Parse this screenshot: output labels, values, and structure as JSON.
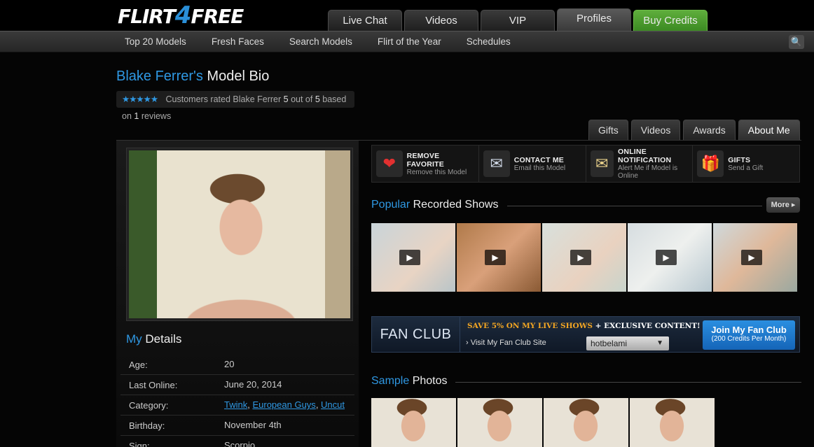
{
  "header": {
    "logo_main": "FLIRT",
    "logo_four": "4",
    "logo_end": "FREE",
    "tabs": [
      {
        "label": "Live Chat"
      },
      {
        "label": "Videos"
      },
      {
        "label": "VIP"
      },
      {
        "label": "Profiles"
      },
      {
        "label": "Buy Credits"
      }
    ]
  },
  "subnav": {
    "items": [
      "Top 20 Models",
      "Fresh Faces",
      "Search Models",
      "Flirt of the Year",
      "Schedules"
    ],
    "search_icon": "🔍"
  },
  "profile": {
    "name_possessive": "Blake Ferrer's",
    "title_suffix": "Model Bio",
    "stars": "★★★★★",
    "rating_prefix": "Customers rated Blake Ferrer",
    "rating_value": "5",
    "rating_mid": "out of",
    "rating_max": "5",
    "rating_based": "based on",
    "review_count": "1",
    "rating_suffix": "reviews",
    "rating_fraction": 1.0
  },
  "profile_tabs": [
    "Gifts",
    "Videos",
    "Awards",
    "About Me"
  ],
  "actions": [
    {
      "icon": "heart-icon",
      "glyph": "❤",
      "title": "REMOVE FAVORITE",
      "sub": "Remove this Model"
    },
    {
      "icon": "envelope-icon",
      "glyph": "✉",
      "title": "CONTACT ME",
      "sub": "Email this Model"
    },
    {
      "icon": "notification-icon",
      "glyph": "✉",
      "title": "ONLINE NOTIFICATION",
      "sub": "Alert Me if Model is Online"
    },
    {
      "icon": "gift-icon",
      "glyph": "🎁",
      "title": "GIFTS",
      "sub": "Send a Gift"
    }
  ],
  "recorded": {
    "title_hl": "Popular",
    "title": "Recorded Shows",
    "more": "More ▸",
    "play_glyph": "▶"
  },
  "fanclub": {
    "label": "FAN CLUB",
    "promo": "SAVE 5% ON MY LIVE SHOWS",
    "promo_plus": "+ EXCLUSIVE CONTENT!",
    "link": "› Visit My Fan Club Site",
    "select_value": "hotbelami",
    "join_title": "Join My Fan Club",
    "join_sub": "(200 Credits Per Month)"
  },
  "sample": {
    "title_hl": "Sample",
    "title": "Photos"
  },
  "details": {
    "title_hl": "My",
    "title": "Details",
    "rows": [
      {
        "label": "Age:",
        "value": "20"
      },
      {
        "label": "Last Online:",
        "value": "June 20, 2014"
      },
      {
        "label": "Category:",
        "links": [
          "Twink",
          "European Guys",
          "Uncut"
        ]
      },
      {
        "label": "Birthday:",
        "value": "November 4th"
      },
      {
        "label": "Sign:",
        "value": "Scorpio"
      }
    ]
  },
  "colors": {
    "accent": "#2f98e3",
    "buy": "#4c9c2e",
    "promo": "#f3a623"
  }
}
